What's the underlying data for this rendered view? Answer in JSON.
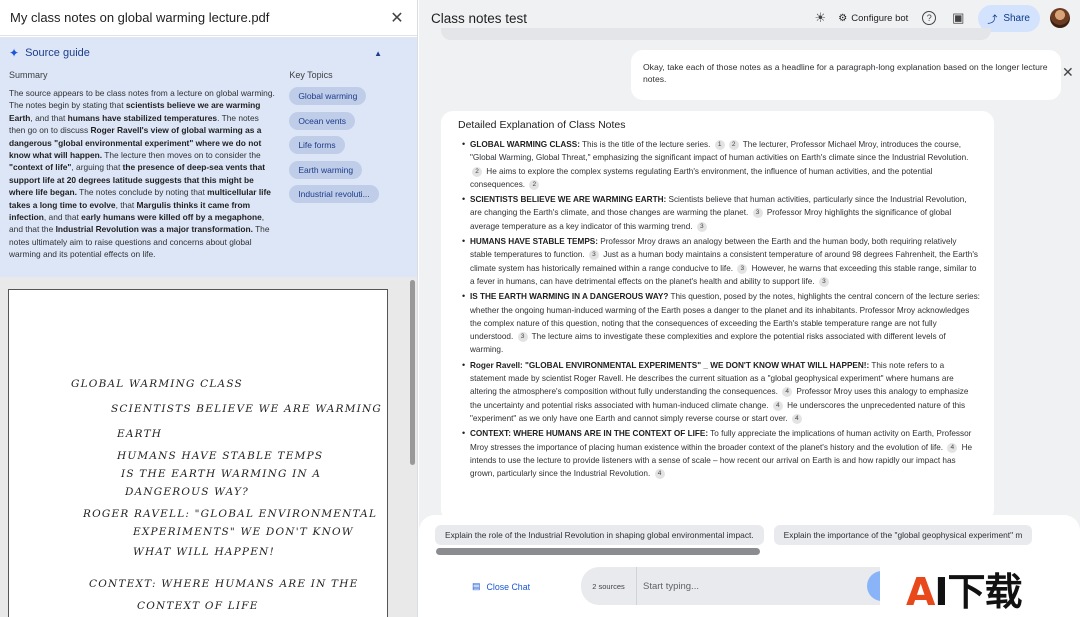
{
  "source_panel": {
    "title": "My class notes on global warming lecture.pdf",
    "close_icon": "close-icon",
    "guide_label": "Source guide",
    "summary_label": "Summary",
    "summary_html": "The source appears to be class notes from a lecture on global warming. The notes begin by stating that <b>scientists believe we are warming Earth</b>, and that <b>humans have stabilized temperatures</b>. The notes then go on to discuss <b>Roger Ravell's view of global warming as a dangerous \"global environmental experiment\" where we do not know what will happen.</b> The lecture then moves on to consider the <b>\"context of life\"</b>, arguing that <b>the presence of deep-sea vents that support life at 20 degrees latitude suggests that this might be where life began.</b> The notes conclude by noting that <b>multicellular life takes a long time to evolve</b>, that <b>Margulis thinks it came from infection</b>, and that <b>early humans were killed off by a megaphone</b>, and that the <b>Industrial Revolution was a major transformation.</b> The notes ultimately aim to raise questions and concerns about global warming and its potential effects on life.",
    "topics_label": "Key Topics",
    "topics": [
      "Global warming",
      "Ocean vents",
      "Life forms",
      "Earth warming",
      "Industrial revoluti..."
    ],
    "handwriting": [
      "Global warming class",
      "Scientists believe we are warming",
      "Earth",
      "Humans have stable temps",
      "Is the Earth warming in a",
      "dangerous way?",
      "Roger Ravell: \"global environmental",
      "experiments\" we don't know",
      "what will happen!",
      "Context: where humans are in the",
      "context of life"
    ]
  },
  "chat_panel": {
    "title": "Class notes test",
    "configure_label": "Configure bot",
    "share_label": "Share",
    "user_message": "Okay, take each of those notes as a headline for a paragraph-long explanation based on the longer lecture notes.",
    "response_title": "Detailed Explanation of Class Notes",
    "response_items_html": [
      "<b>GLOBAL WARMING CLASS:</b> This is the title of the lecture series. <span class=\"cite\">1</span><span class=\"cite\">2</span> The lecturer, Professor Michael Mroy, introduces the course, \"Global Warming, Global Threat,\" emphasizing the significant impact of human activities on Earth's climate since the Industrial Revolution. <span class=\"cite\">2</span> He aims to explore the complex systems regulating Earth's environment, the influence of human activities, and the potential consequences. <span class=\"cite\">2</span>",
      "<b>SCIENTISTS BELIEVE WE ARE WARMING EARTH:</b> Scientists believe that human activities, particularly since the Industrial Revolution, are changing the Earth's climate, and those changes are warming the planet. <span class=\"cite\">3</span> Professor Mroy highlights the significance of global average temperature as a key indicator of this warming trend. <span class=\"cite\">3</span>",
      "<b>HUMANS HAVE STABLE TEMPS:</b> Professor Mroy draws an analogy between the Earth and the human body, both requiring relatively stable temperatures to function. <span class=\"cite\">3</span> Just as a human body maintains a consistent temperature of around 98 degrees Fahrenheit, the Earth's climate system has historically remained within a range conducive to life. <span class=\"cite\">3</span> However, he warns that exceeding this stable range, similar to a fever in humans, can have detrimental effects on the planet's health and ability to support life. <span class=\"cite\">3</span>",
      "<b>IS THE EARTH WARMING IN A DANGEROUS WAY?</b> This question, posed by the notes, highlights the central concern of the lecture series: whether the ongoing human-induced warming of the Earth poses a danger to the planet and its inhabitants. Professor Mroy acknowledges the complex nature of this question, noting that the consequences of exceeding the Earth's stable temperature range are not fully understood. <span class=\"cite\">3</span> The lecture aims to investigate these complexities and explore the potential risks associated with different levels of warming.",
      "<b>Roger Ravell: \"GLOBAL ENVIRONMENTAL EXPERIMENTS\" _ WE DON'T KNOW WHAT WILL HAPPEN!:</b> This note refers to a statement made by scientist Roger Ravell. He describes the current situation as a \"global geophysical experiment\" where humans are altering the atmosphere's composition without fully understanding the consequences. <span class=\"cite\">4</span> Professor Mroy uses this analogy to emphasize the uncertainty and potential risks associated with human-induced climate change. <span class=\"cite\">4</span> He underscores the unprecedented nature of this \"experiment\" as we only have one Earth and cannot simply reverse course or start over. <span class=\"cite\">4</span>",
      "<b>CONTEXT: WHERE HUMANS ARE IN THE CONTEXT OF LIFE:</b> To fully appreciate the implications of human activity on Earth, Professor Mroy stresses the importance of placing human existence within the broader context of the planet's history and the evolution of life. <span class=\"cite\">4</span> He intends to use the lecture to provide listeners with a sense of scale – how recent our arrival on Earth is and how rapidly our impact has grown, particularly since the Industrial Revolution. <span class=\"cite\">4</span>"
    ],
    "suggestions": [
      "Explain the role of the Industrial Revolution in shaping global environmental impact.",
      "Explain the importance of the \"global geophysical experiment\" m"
    ],
    "close_chat_label": "Close Chat",
    "sources_count": "2 sources",
    "input_placeholder": "Start typing..."
  },
  "watermark": {
    "prefix": "A",
    "rest": "I下载"
  }
}
